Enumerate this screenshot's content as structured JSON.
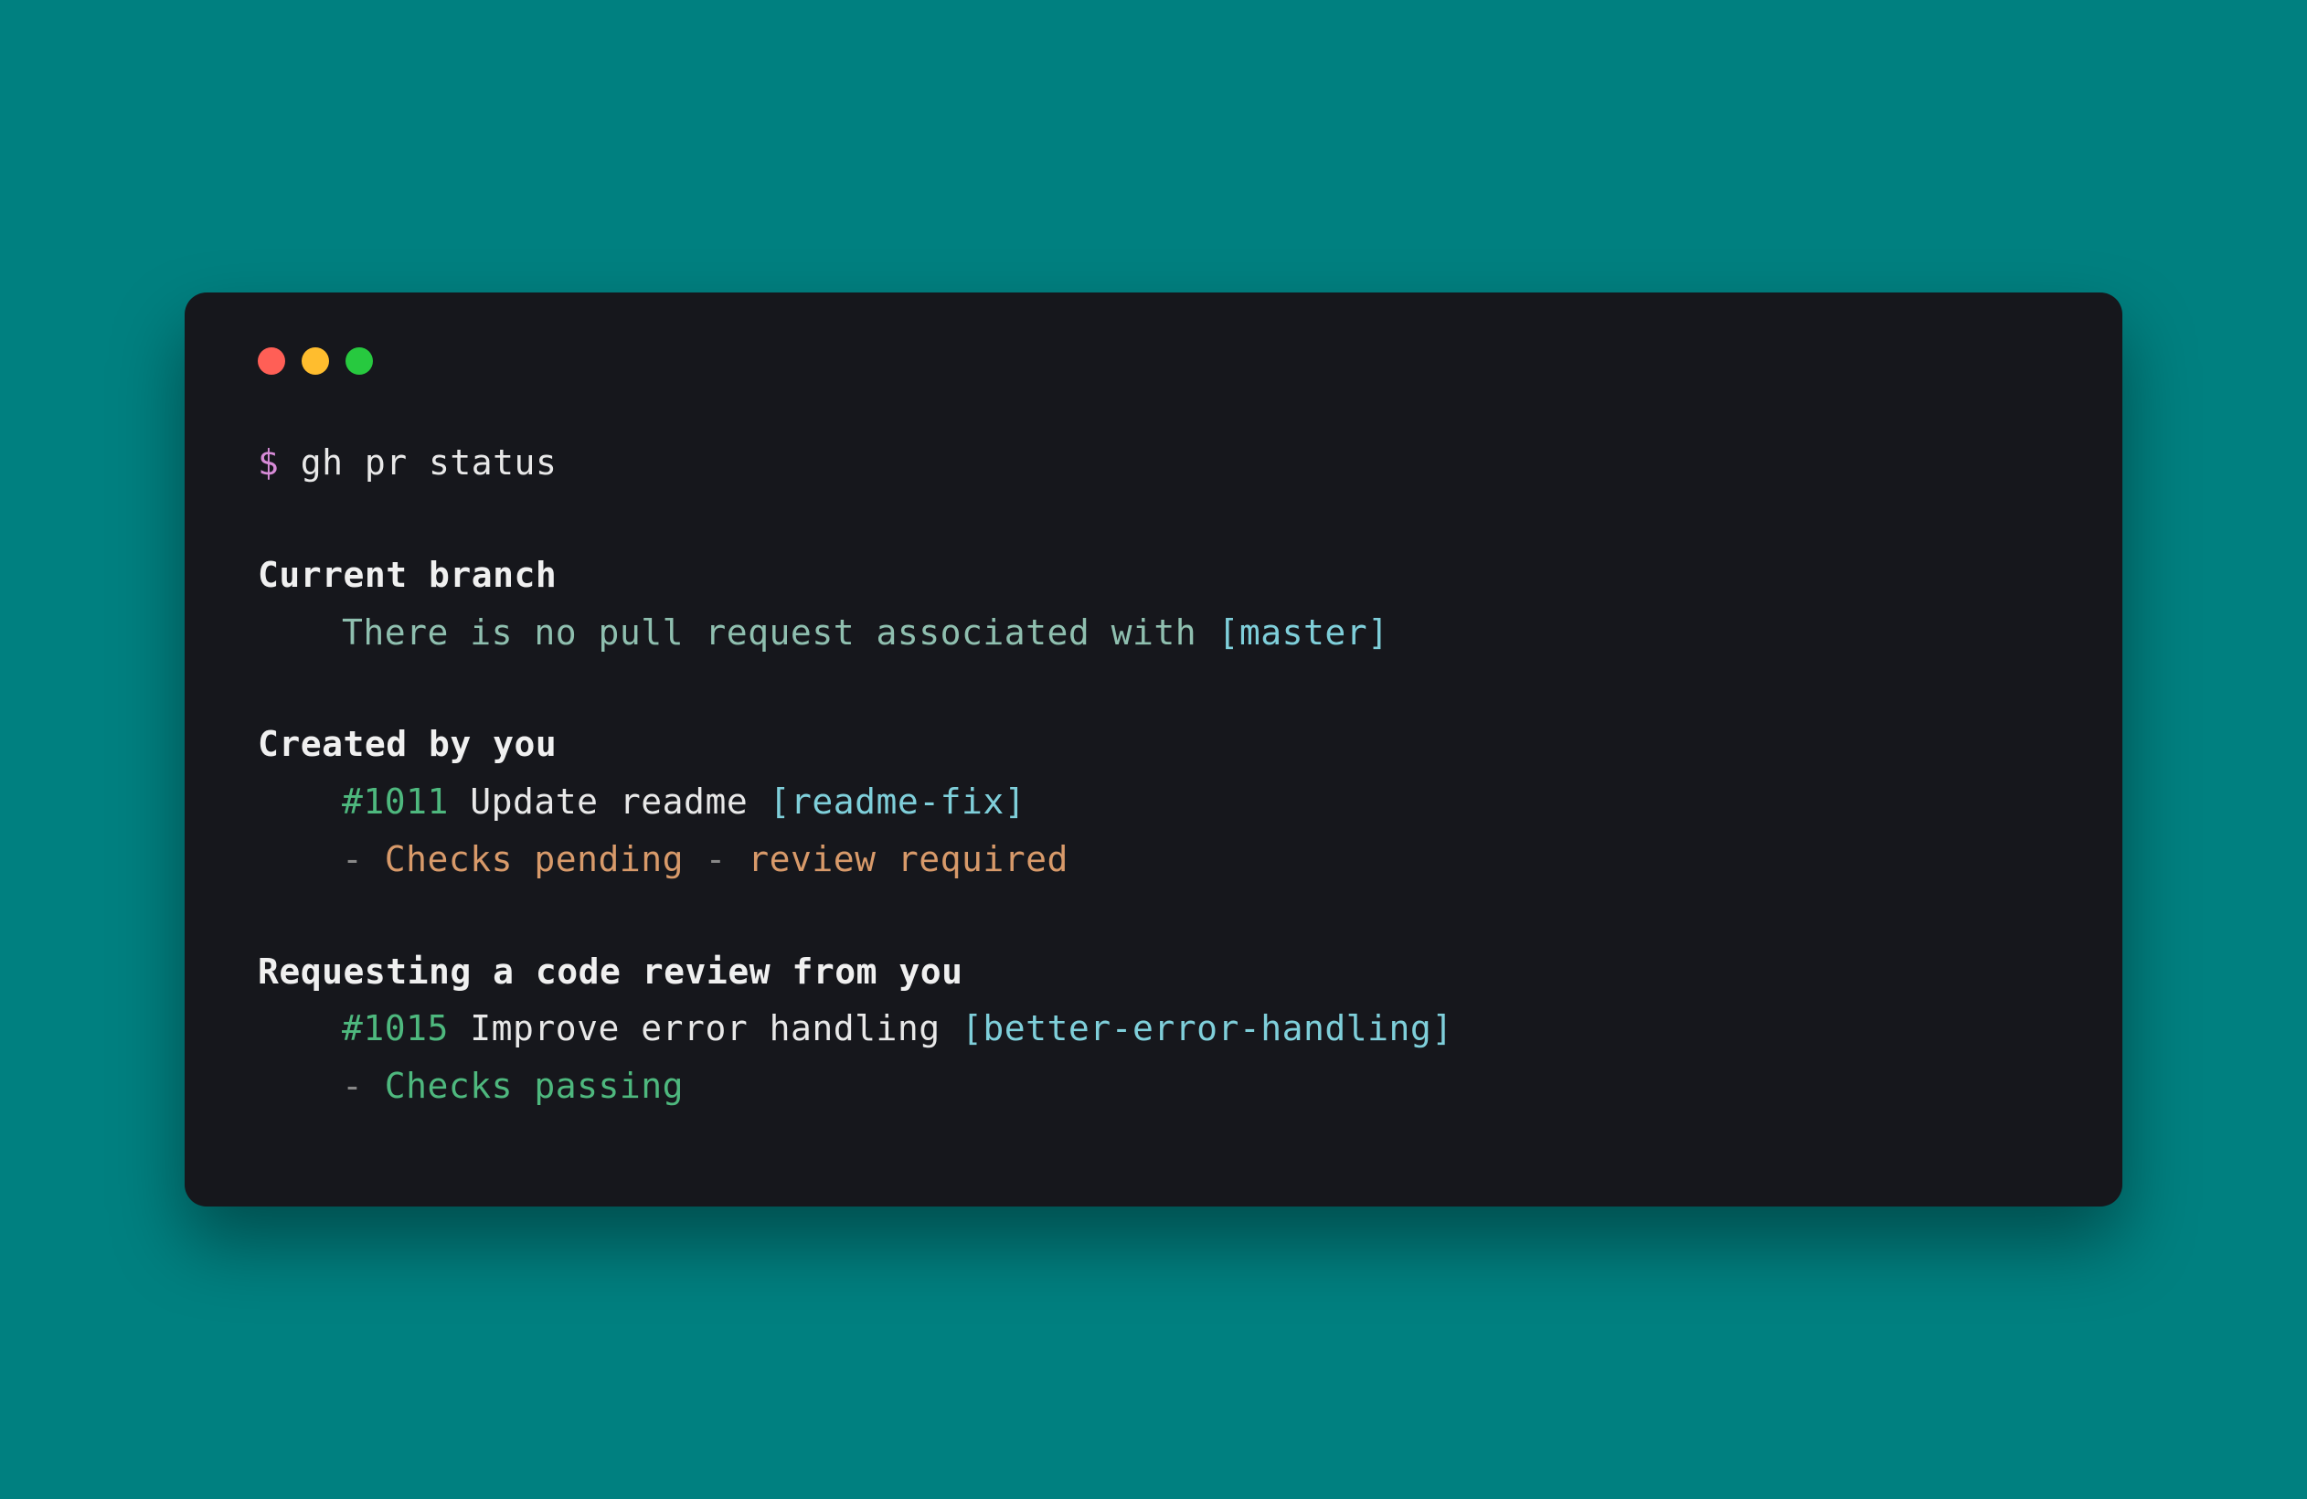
{
  "prompt": {
    "symbol": "$",
    "command": "gh pr status"
  },
  "sections": {
    "current_branch": {
      "header": "Current branch",
      "message": "There is no pull request associated with ",
      "branch": "[master]"
    },
    "created_by_you": {
      "header": "Created by you",
      "pr": {
        "number": "#1011",
        "title": "Update readme",
        "branch": "[readme-fix]",
        "dash1": "- ",
        "status1": "Checks pending",
        "dash2": " - ",
        "status2": "review required"
      }
    },
    "requesting_review": {
      "header": "Requesting a code review from you",
      "pr": {
        "number": "#1015",
        "title": "Improve error handling",
        "branch": "[better-error-handling]",
        "dash1": "- ",
        "status1": "Checks passing"
      }
    }
  }
}
